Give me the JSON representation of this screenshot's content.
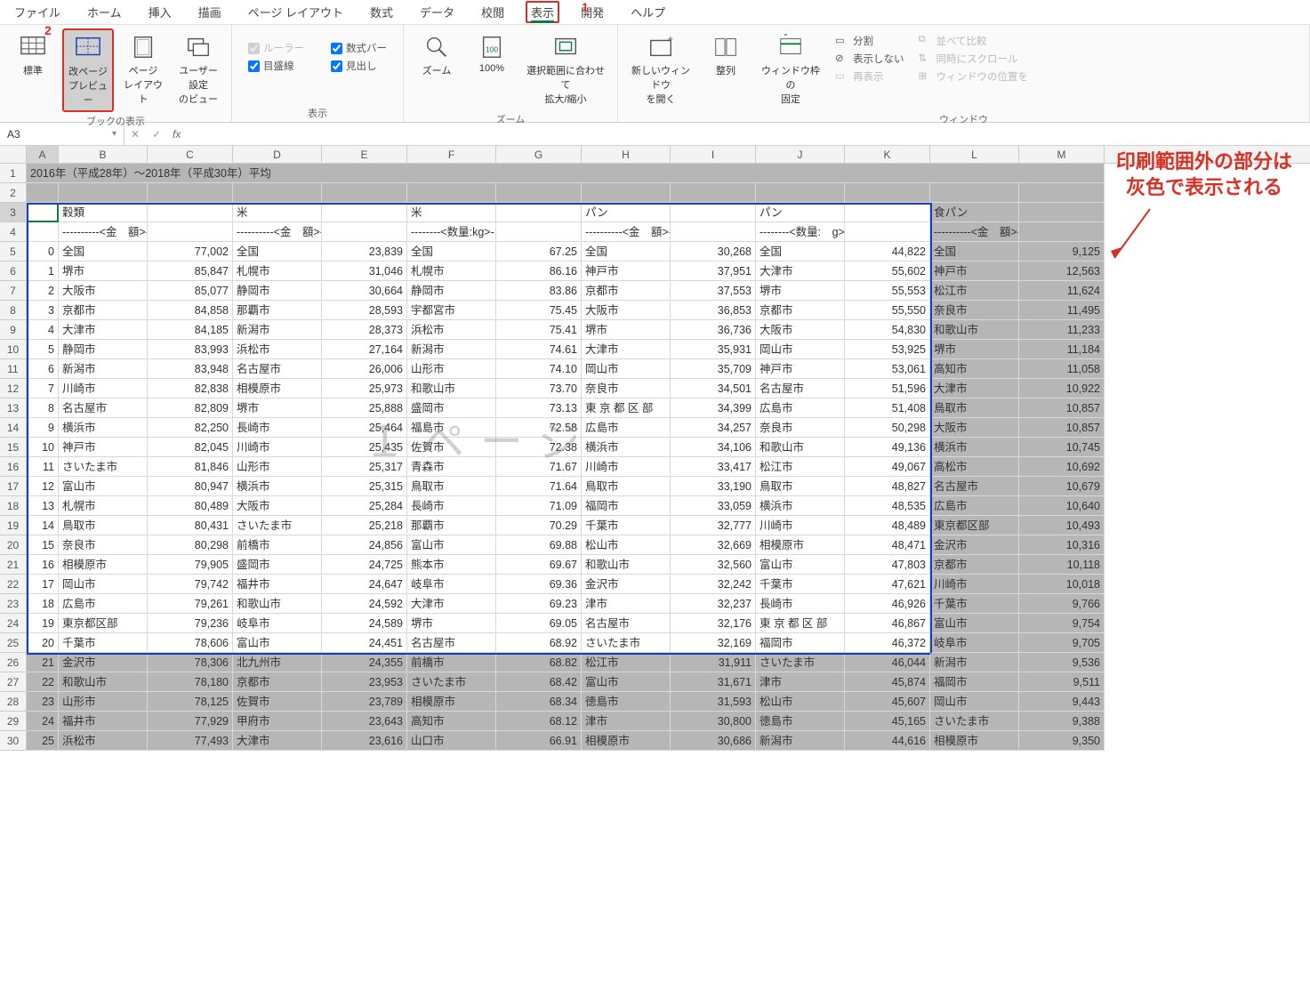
{
  "menu": {
    "items": [
      "ファイル",
      "ホーム",
      "挿入",
      "描画",
      "ページ レイアウト",
      "数式",
      "データ",
      "校閲",
      "表示",
      "開発",
      "ヘルプ"
    ],
    "active_index": 8
  },
  "callouts": {
    "num1": "1",
    "num2": "2"
  },
  "ribbon": {
    "groups": {
      "book_view": {
        "label": "ブックの表示",
        "buttons": {
          "normal": "標準",
          "page_break": "改ページ\nプレビュー",
          "page_layout": "ページ\nレイアウト",
          "custom": "ユーザー設定\nのビュー"
        }
      },
      "show": {
        "label": "表示",
        "checks": {
          "ruler": "ルーラー",
          "formula_bar": "数式バー",
          "gridlines": "目盛線",
          "headings": "見出し"
        }
      },
      "zoom": {
        "label": "ズーム",
        "buttons": {
          "zoom": "ズーム",
          "pct100": "100%",
          "fit_selection": "選択範囲に合わせて\n拡大/縮小"
        }
      },
      "window": {
        "label": "ウィンドウ",
        "buttons": {
          "new_window": "新しいウィンドウ\nを開く",
          "arrange": "整列",
          "freeze": "ウィンドウ枠の\n固定"
        },
        "small": {
          "split": "分割",
          "hide": "表示しない",
          "unhide": "再表示",
          "side_by_side": "並べて比較",
          "sync_scroll": "同時にスクロール",
          "reset_pos": "ウィンドウの位置を"
        }
      }
    }
  },
  "formula_bar": {
    "name_box": "A3",
    "fx": "fx",
    "value": ""
  },
  "annotation": {
    "line1": "印刷範囲外の部分は",
    "line2": "灰色で表示される"
  },
  "grid": {
    "columns": [
      "A",
      "B",
      "C",
      "D",
      "E",
      "F",
      "G",
      "H",
      "I",
      "J",
      "K",
      "L",
      "M"
    ],
    "title_row": "2016年（平成28年）～2018年（平成30年）平均",
    "headers_row3": [
      "",
      "穀類",
      "",
      "米",
      "",
      "米",
      "",
      "パン",
      "",
      "パン",
      "",
      "食パン",
      ""
    ],
    "headers_row4": [
      "",
      "----------<金　額>-",
      "",
      "----------<金　額>-",
      "",
      "--------<数量:kg>-",
      "",
      "----------<金　額>-",
      "",
      "--------<数量:　g>-",
      "",
      "----------<金　額>-",
      ""
    ],
    "watermark": "１ページ",
    "rows": [
      {
        "r": 5,
        "A": "0",
        "B": "全国",
        "C": "77,002",
        "D": "全国",
        "E": "23,839",
        "F": "全国",
        "G": "67.25",
        "H": "全国",
        "I": "30,268",
        "J": "全国",
        "K": "44,822",
        "L": "全国",
        "M": "9,125"
      },
      {
        "r": 6,
        "A": "1",
        "B": "堺市",
        "C": "85,847",
        "D": "札幌市",
        "E": "31,046",
        "F": "札幌市",
        "G": "86.16",
        "H": "神戸市",
        "I": "37,951",
        "J": "大津市",
        "K": "55,602",
        "L": "神戸市",
        "M": "12,563"
      },
      {
        "r": 7,
        "A": "2",
        "B": "大阪市",
        "C": "85,077",
        "D": "静岡市",
        "E": "30,664",
        "F": "静岡市",
        "G": "83.86",
        "H": "京都市",
        "I": "37,553",
        "J": "堺市",
        "K": "55,553",
        "L": "松江市",
        "M": "11,624"
      },
      {
        "r": 8,
        "A": "3",
        "B": "京都市",
        "C": "84,858",
        "D": "那覇市",
        "E": "28,593",
        "F": "宇都宮市",
        "G": "75.45",
        "H": "大阪市",
        "I": "36,853",
        "J": "京都市",
        "K": "55,550",
        "L": "奈良市",
        "M": "11,495"
      },
      {
        "r": 9,
        "A": "4",
        "B": "大津市",
        "C": "84,185",
        "D": "新潟市",
        "E": "28,373",
        "F": "浜松市",
        "G": "75.41",
        "H": "堺市",
        "I": "36,736",
        "J": "大阪市",
        "K": "54,830",
        "L": "和歌山市",
        "M": "11,233"
      },
      {
        "r": 10,
        "A": "5",
        "B": "静岡市",
        "C": "83,993",
        "D": "浜松市",
        "E": "27,164",
        "F": "新潟市",
        "G": "74.61",
        "H": "大津市",
        "I": "35,931",
        "J": "岡山市",
        "K": "53,925",
        "L": "堺市",
        "M": "11,184"
      },
      {
        "r": 11,
        "A": "6",
        "B": "新潟市",
        "C": "83,948",
        "D": "名古屋市",
        "E": "26,006",
        "F": "山形市",
        "G": "74.10",
        "H": "岡山市",
        "I": "35,709",
        "J": "神戸市",
        "K": "53,061",
        "L": "高知市",
        "M": "11,058"
      },
      {
        "r": 12,
        "A": "7",
        "B": "川崎市",
        "C": "82,838",
        "D": "相模原市",
        "E": "25,973",
        "F": "和歌山市",
        "G": "73.70",
        "H": "奈良市",
        "I": "34,501",
        "J": "名古屋市",
        "K": "51,596",
        "L": "大津市",
        "M": "10,922"
      },
      {
        "r": 13,
        "A": "8",
        "B": "名古屋市",
        "C": "82,809",
        "D": "堺市",
        "E": "25,888",
        "F": "盛岡市",
        "G": "73.13",
        "H": "東 京 都 区 部",
        "I": "34,399",
        "J": "広島市",
        "K": "51,408",
        "L": "鳥取市",
        "M": "10,857"
      },
      {
        "r": 14,
        "A": "9",
        "B": "横浜市",
        "C": "82,250",
        "D": "長崎市",
        "E": "25,464",
        "F": "福島市",
        "G": "72.58",
        "H": "広島市",
        "I": "34,257",
        "J": "奈良市",
        "K": "50,298",
        "L": "大阪市",
        "M": "10,857"
      },
      {
        "r": 15,
        "A": "10",
        "B": "神戸市",
        "C": "82,045",
        "D": "川崎市",
        "E": "25,435",
        "F": "佐賀市",
        "G": "72.38",
        "H": "横浜市",
        "I": "34,106",
        "J": "和歌山市",
        "K": "49,136",
        "L": "横浜市",
        "M": "10,745"
      },
      {
        "r": 16,
        "A": "11",
        "B": "さいたま市",
        "C": "81,846",
        "D": "山形市",
        "E": "25,317",
        "F": "青森市",
        "G": "71.67",
        "H": "川崎市",
        "I": "33,417",
        "J": "松江市",
        "K": "49,067",
        "L": "高松市",
        "M": "10,692"
      },
      {
        "r": 17,
        "A": "12",
        "B": "富山市",
        "C": "80,947",
        "D": "横浜市",
        "E": "25,315",
        "F": "鳥取市",
        "G": "71.64",
        "H": "鳥取市",
        "I": "33,190",
        "J": "鳥取市",
        "K": "48,827",
        "L": "名古屋市",
        "M": "10,679"
      },
      {
        "r": 18,
        "A": "13",
        "B": "札幌市",
        "C": "80,489",
        "D": "大阪市",
        "E": "25,284",
        "F": "長崎市",
        "G": "71.09",
        "H": "福岡市",
        "I": "33,059",
        "J": "横浜市",
        "K": "48,535",
        "L": "広島市",
        "M": "10,640"
      },
      {
        "r": 19,
        "A": "14",
        "B": "鳥取市",
        "C": "80,431",
        "D": "さいたま市",
        "E": "25,218",
        "F": "那覇市",
        "G": "70.29",
        "H": "千葉市",
        "I": "32,777",
        "J": "川崎市",
        "K": "48,489",
        "L": "東京都区部",
        "M": "10,493"
      },
      {
        "r": 20,
        "A": "15",
        "B": "奈良市",
        "C": "80,298",
        "D": "前橋市",
        "E": "24,856",
        "F": "富山市",
        "G": "69.88",
        "H": "松山市",
        "I": "32,669",
        "J": "相模原市",
        "K": "48,471",
        "L": "金沢市",
        "M": "10,316"
      },
      {
        "r": 21,
        "A": "16",
        "B": "相模原市",
        "C": "79,905",
        "D": "盛岡市",
        "E": "24,725",
        "F": "熊本市",
        "G": "69.67",
        "H": "和歌山市",
        "I": "32,560",
        "J": "富山市",
        "K": "47,803",
        "L": "京都市",
        "M": "10,118"
      },
      {
        "r": 22,
        "A": "17",
        "B": "岡山市",
        "C": "79,742",
        "D": "福井市",
        "E": "24,647",
        "F": "岐阜市",
        "G": "69.36",
        "H": "金沢市",
        "I": "32,242",
        "J": "千葉市",
        "K": "47,621",
        "L": "川崎市",
        "M": "10,018"
      },
      {
        "r": 23,
        "A": "18",
        "B": "広島市",
        "C": "79,261",
        "D": "和歌山市",
        "E": "24,592",
        "F": "大津市",
        "G": "69.23",
        "H": "津市",
        "I": "32,237",
        "J": "長崎市",
        "K": "46,926",
        "L": "千葉市",
        "M": "9,766"
      },
      {
        "r": 24,
        "A": "19",
        "B": "東京都区部",
        "C": "79,236",
        "D": "岐阜市",
        "E": "24,589",
        "F": "堺市",
        "G": "69.05",
        "H": "名古屋市",
        "I": "32,176",
        "J": "東 京 都 区 部",
        "K": "46,867",
        "L": "富山市",
        "M": "9,754"
      },
      {
        "r": 25,
        "A": "20",
        "B": "千葉市",
        "C": "78,606",
        "D": "富山市",
        "E": "24,451",
        "F": "名古屋市",
        "G": "68.92",
        "H": "さいたま市",
        "I": "32,169",
        "J": "福岡市",
        "K": "46,372",
        "L": "岐阜市",
        "M": "9,705"
      },
      {
        "r": 26,
        "A": "21",
        "B": "金沢市",
        "C": "78,306",
        "D": "北九州市",
        "E": "24,355",
        "F": "前橋市",
        "G": "68.82",
        "H": "松江市",
        "I": "31,911",
        "J": "さいたま市",
        "K": "46,044",
        "L": "新潟市",
        "M": "9,536"
      },
      {
        "r": 27,
        "A": "22",
        "B": "和歌山市",
        "C": "78,180",
        "D": "京都市",
        "E": "23,953",
        "F": "さいたま市",
        "G": "68.42",
        "H": "富山市",
        "I": "31,671",
        "J": "津市",
        "K": "45,874",
        "L": "福岡市",
        "M": "9,511"
      },
      {
        "r": 28,
        "A": "23",
        "B": "山形市",
        "C": "78,125",
        "D": "佐賀市",
        "E": "23,789",
        "F": "相模原市",
        "G": "68.34",
        "H": "徳島市",
        "I": "31,593",
        "J": "松山市",
        "K": "45,607",
        "L": "岡山市",
        "M": "9,443"
      },
      {
        "r": 29,
        "A": "24",
        "B": "福井市",
        "C": "77,929",
        "D": "甲府市",
        "E": "23,643",
        "F": "高知市",
        "G": "68.12",
        "H": "津市",
        "I": "30,800",
        "J": "徳島市",
        "K": "45,165",
        "L": "さいたま市",
        "M": "9,388"
      },
      {
        "r": 30,
        "A": "25",
        "B": "浜松市",
        "C": "77,493",
        "D": "大津市",
        "E": "23,616",
        "F": "山口市",
        "G": "66.91",
        "H": "相模原市",
        "I": "30,686",
        "J": "新潟市",
        "K": "44,616",
        "L": "相模原市",
        "M": "9,350"
      }
    ]
  }
}
